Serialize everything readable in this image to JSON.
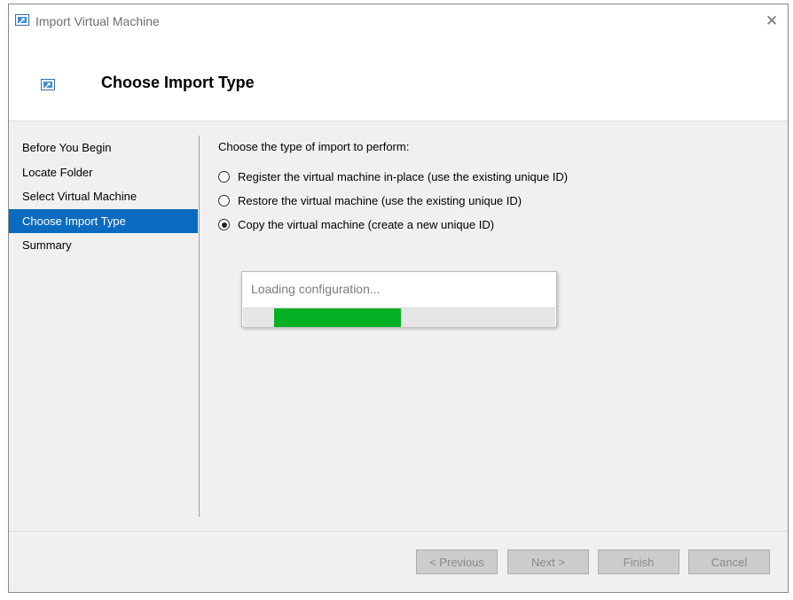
{
  "window": {
    "title": "Import Virtual Machine"
  },
  "header": {
    "title": "Choose Import Type"
  },
  "nav": {
    "items": [
      {
        "label": "Before You Begin",
        "active": false
      },
      {
        "label": "Locate Folder",
        "active": false
      },
      {
        "label": "Select Virtual Machine",
        "active": false
      },
      {
        "label": "Choose Import Type",
        "active": true
      },
      {
        "label": "Summary",
        "active": false
      }
    ]
  },
  "content": {
    "instruction": "Choose the type of import to perform:",
    "options": [
      {
        "label": "Register the virtual machine in-place (use the existing unique ID)",
        "checked": false
      },
      {
        "label": "Restore the virtual machine (use the existing unique ID)",
        "checked": false
      },
      {
        "label": "Copy the virtual machine (create a new unique ID)",
        "checked": true
      }
    ]
  },
  "progress": {
    "text": "Loading configuration...",
    "fill_fraction": 0.45,
    "color": "#06b025"
  },
  "buttons": {
    "previous": "< Previous",
    "next": "Next >",
    "finish": "Finish",
    "cancel": "Cancel"
  },
  "colors": {
    "accent": "#0a6bc1"
  }
}
